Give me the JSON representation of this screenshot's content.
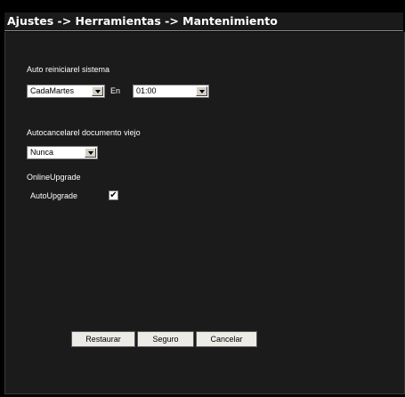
{
  "breadcrumb": "Ajustes -> Herramientas -> Mantenimiento",
  "auto_reboot": {
    "label": "Auto reiniciarel sistema",
    "frequency_value": "CadaMartes",
    "at_label": "En",
    "time_value": "01:00"
  },
  "auto_delete": {
    "label": "Autocancelarel documento viejo",
    "value": "Nunca"
  },
  "online_upgrade": {
    "label": "OnlineUpgrade",
    "auto_label": "AutoUpgrade",
    "auto_checked": true,
    "check_glyph": "✔"
  },
  "buttons": {
    "restore": "Restaurar",
    "save": "Seguro",
    "cancel": "Cancelar"
  }
}
